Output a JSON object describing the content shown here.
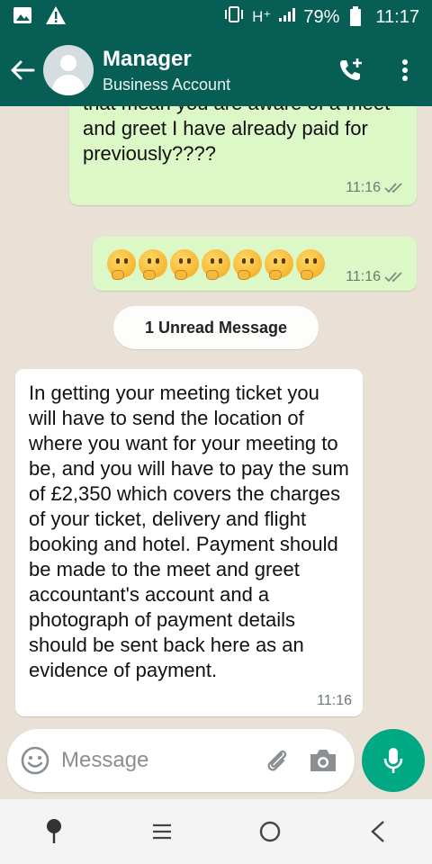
{
  "status_bar": {
    "network": "H⁺",
    "battery_percent": "79%",
    "time": "11:17"
  },
  "header": {
    "contact_name": "Manager",
    "contact_subtitle": "Business Account",
    "icons": [
      "back-arrow-icon",
      "avatar",
      "add-call-icon",
      "more-vert-icon"
    ]
  },
  "messages": [
    {
      "direction": "outgoing",
      "text": "I have always been showing,Does that mean you are aware of a meet and greet I have already paid for previously????",
      "time": "11:16",
      "status": "read"
    },
    {
      "direction": "outgoing",
      "emoji_count": 7,
      "emoji_name": "thinking-face",
      "time": "11:16",
      "status": "read"
    },
    {
      "type": "divider",
      "text": "1 Unread Message"
    },
    {
      "direction": "incoming",
      "text": "In getting your meeting ticket you will have to send the location of where you want for your meeting to be, and you will have to pay the sum of £2,350 which covers the charges of your ticket, delivery and flight booking and hotel. Payment should be made to the meet and greet accountant's account and a photograph of payment details should be sent back here as an evidence of payment.",
      "time": "11:16"
    }
  ],
  "composer": {
    "placeholder": "Message"
  },
  "colors": {
    "header": "#075e54",
    "outgoing_bubble": "#dcf8c6",
    "incoming_bubble": "#ffffff",
    "mic_button": "#00a884",
    "read_ticks": "#8a9a8e"
  }
}
